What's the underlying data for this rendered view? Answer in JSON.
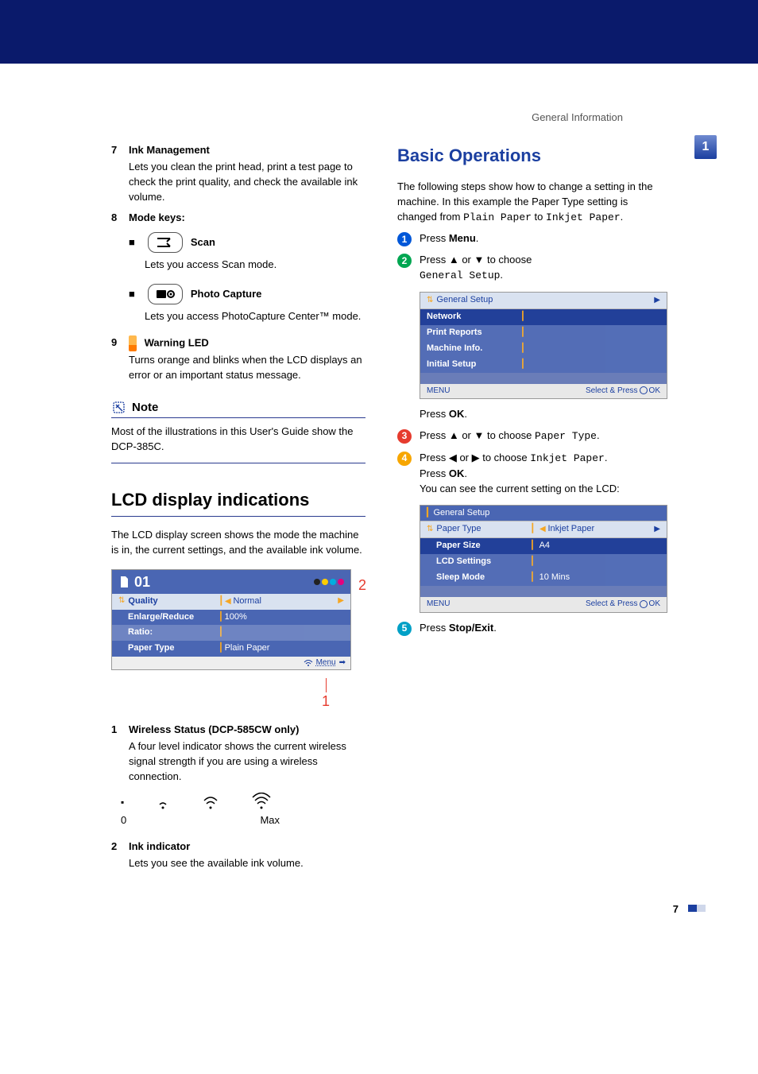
{
  "header_label": "General Information",
  "side_tab": "1",
  "left": {
    "items": [
      {
        "n": "7",
        "title": "Ink Management",
        "desc": "Lets you clean the print head, print a test page to check the print quality, and check the available ink volume."
      },
      {
        "n": "8",
        "title": "Mode keys:"
      }
    ],
    "modes": [
      {
        "label": "Scan",
        "desc": "Lets you access Scan mode."
      },
      {
        "label": "Photo Capture",
        "desc": "Lets you access PhotoCapture Center™ mode."
      }
    ],
    "item9": {
      "n": "9",
      "title": "Warning LED",
      "desc": "Turns orange and blinks when the LCD displays an error or an important status message."
    },
    "note_label": "Note",
    "note_body": "Most of the illustrations in this User's Guide show the DCP-385C.",
    "h2": "LCD display indications",
    "lcd_intro": "The LCD display screen shows the mode the machine is in, the current settings, and the available ink volume.",
    "lcd_main": {
      "number": "01",
      "rows": [
        {
          "l": "Quality",
          "r": "Normal",
          "sel": true,
          "arrows": true
        },
        {
          "l": "Enlarge/Reduce",
          "r": "100%"
        },
        {
          "l": "Ratio:",
          "r": ""
        },
        {
          "l": "Paper Type",
          "r": "Plain Paper"
        }
      ],
      "foot_hint": "Menu"
    },
    "below": [
      {
        "n": "1",
        "title": "Wireless Status (DCP-585CW only)",
        "desc": "A four level indicator shows the current wireless signal strength if you are using a wireless connection."
      },
      {
        "n": "2",
        "title": "Ink indicator",
        "desc": "Lets you see the available ink volume."
      }
    ],
    "wifi_min": "0",
    "wifi_max": "Max"
  },
  "right": {
    "h2": "Basic Operations",
    "intro_pre": "The following steps show how to change a setting in the machine. In this example the Paper Type setting is changed from ",
    "intro_code1": "Plain Paper",
    "intro_mid": " to ",
    "intro_code2": "Inkjet Paper",
    "intro_post": ".",
    "steps": {
      "s1_pre": "Press ",
      "s1_b": "Menu",
      "s1_post": ".",
      "s2_pre": "Press ▲ or ▼ to choose",
      "s2_code": "General Setup",
      "s2_post": ".",
      "s2_ok_pre": "Press ",
      "s2_ok_b": "OK",
      "s2_ok_post": ".",
      "s3_pre": "Press ▲ or ▼ to choose ",
      "s3_code": "Paper Type",
      "s3_post": ".",
      "s4_pre": "Press ◀ or ▶ to choose ",
      "s4_code": "Inkjet Paper",
      "s4_post": ".",
      "s4_ok_pre": "Press ",
      "s4_ok_b": "OK",
      "s4_ok_post": ".",
      "s4_tail": "You can see the current setting on the LCD:",
      "s5_pre": "Press ",
      "s5_b": "Stop/Exit",
      "s5_post": "."
    },
    "lcd1": {
      "header": "General Setup",
      "rows": [
        "Network",
        "Print Reports",
        "Machine Info.",
        "Initial Setup"
      ],
      "menu": "MENU",
      "hint": "Select & Press",
      "ok": "OK"
    },
    "lcd2": {
      "header": "General Setup",
      "rows": [
        {
          "l": "Paper Type",
          "r": "Inkjet Paper",
          "sel": true
        },
        {
          "l": "Paper Size",
          "r": "A4"
        },
        {
          "l": "LCD Settings",
          "r": ""
        },
        {
          "l": "Sleep Mode",
          "r": "10 Mins"
        }
      ],
      "menu": "MENU",
      "hint": "Select & Press",
      "ok": "OK"
    }
  },
  "page_number": "7"
}
